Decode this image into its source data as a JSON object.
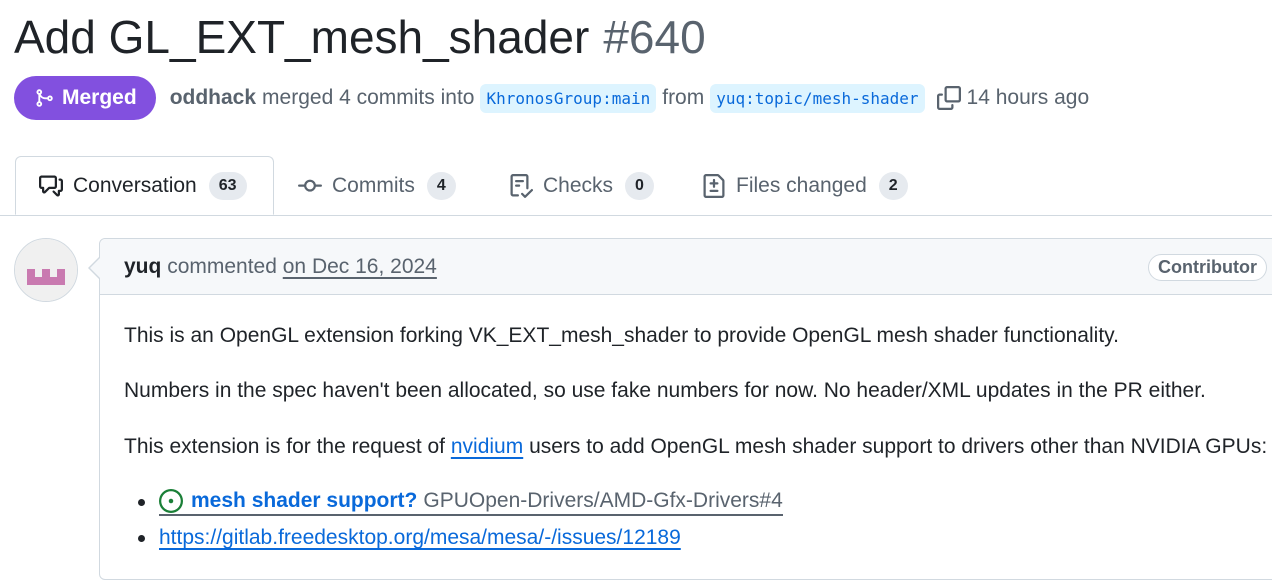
{
  "pr": {
    "title": "Add GL_EXT_mesh_shader",
    "number": "#640",
    "status_label": "Merged",
    "author": "oddhack",
    "merged_text_1": "merged 4 commits into",
    "base_branch": "KhronosGroup:main",
    "from_text": "from",
    "head_branch": "yuq:topic/mesh-shader",
    "time_ago": "14 hours ago",
    "status_color": "#8250df"
  },
  "tabs": [
    {
      "label": "Conversation",
      "count": "63",
      "icon": "comment-discussion-icon",
      "active": true
    },
    {
      "label": "Commits",
      "count": "4",
      "icon": "git-commit-icon",
      "active": false
    },
    {
      "label": "Checks",
      "count": "0",
      "icon": "checklist-icon",
      "active": false
    },
    {
      "label": "Files changed",
      "count": "2",
      "icon": "file-diff-icon",
      "active": false
    }
  ],
  "comment": {
    "user": "yuq",
    "action": "commented",
    "date": "on Dec 16, 2024",
    "role": "Contributor",
    "paragraphs": {
      "p1": "This is an OpenGL extension forking VK_EXT_mesh_shader to provide OpenGL mesh shader functionality.",
      "p2": "Numbers in the spec haven't been allocated, so use fake numbers for now. No header/XML updates in the PR either.",
      "p3_before": "This extension is for the request of",
      "p3_link": "nvidium",
      "p3_after": "users to add OpenGL mesh shader support to drivers other than NVIDIA GPUs:"
    },
    "list": {
      "item1_title": "mesh shader support?",
      "item1_ref": "GPUOpen-Drivers/AMD-Gfx-Drivers#4",
      "item2_url": "https://gitlab.freedesktop.org/mesa/mesa/-/issues/12189"
    }
  }
}
